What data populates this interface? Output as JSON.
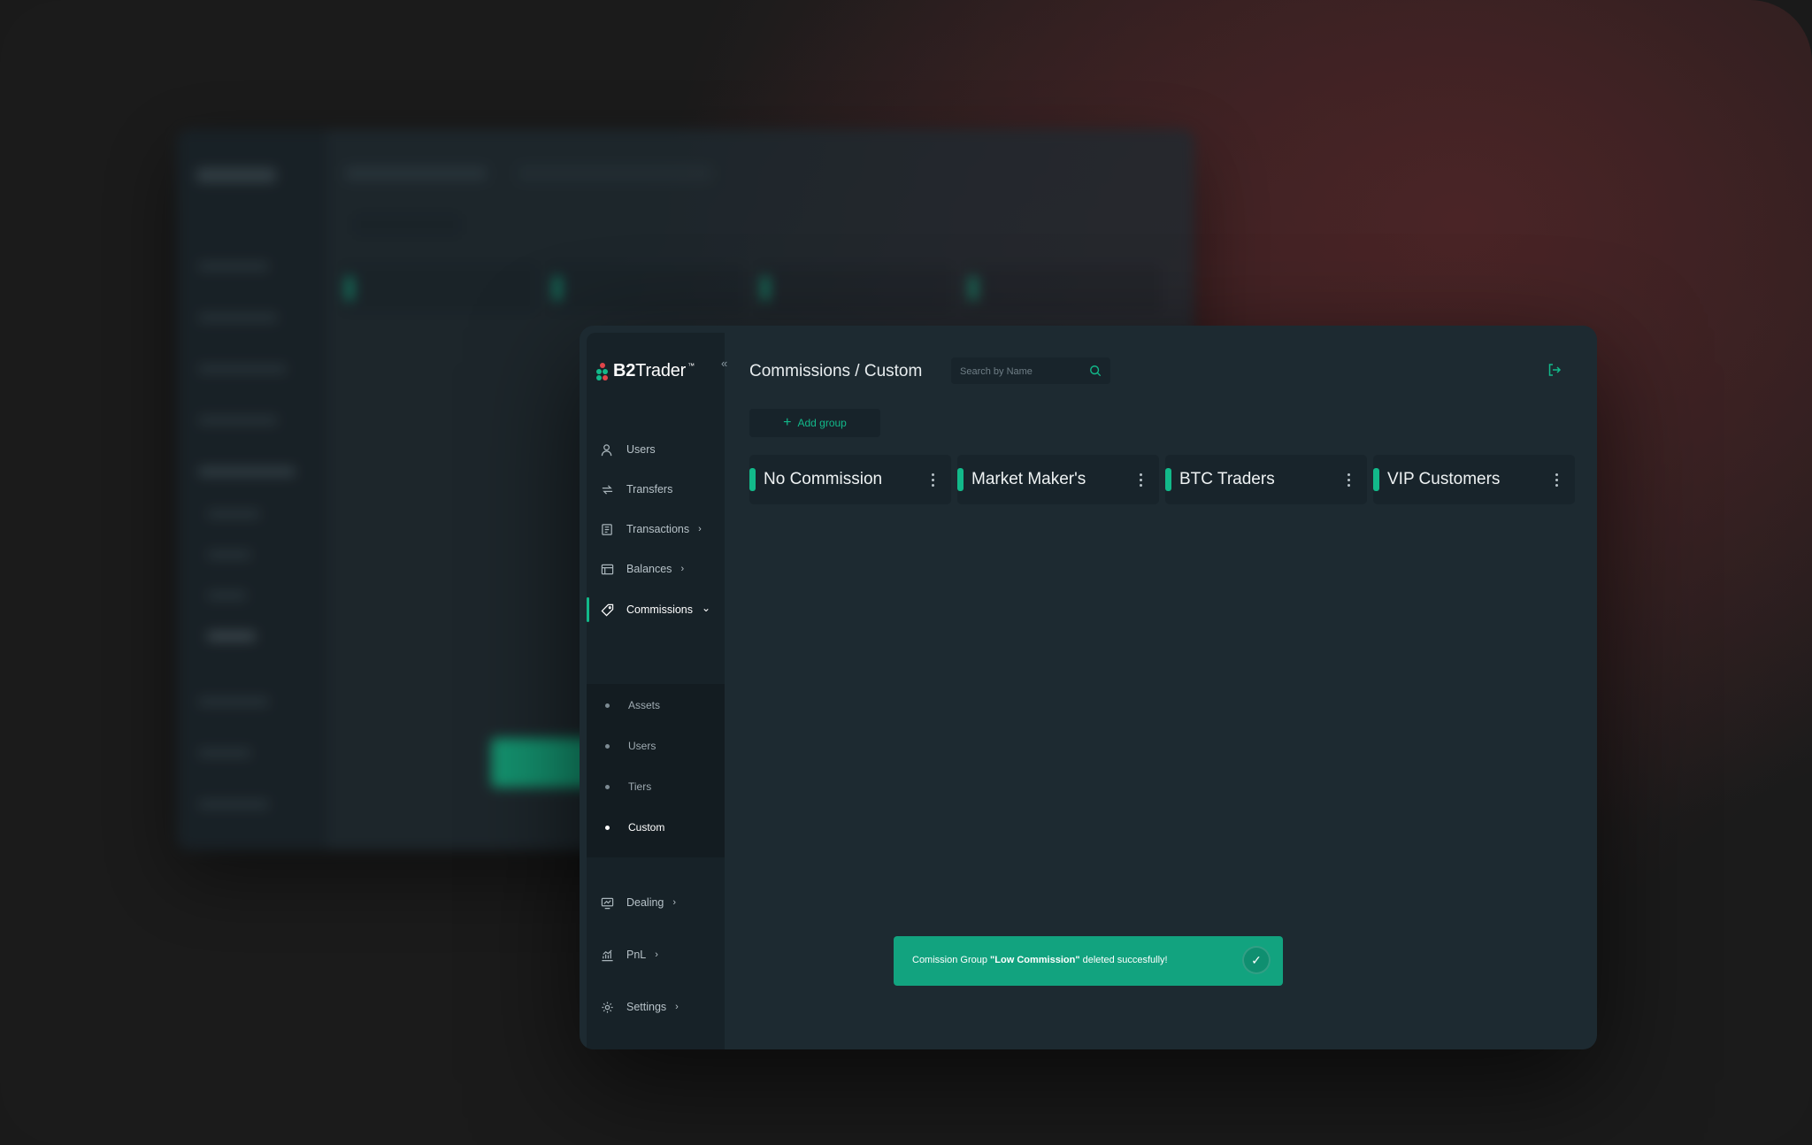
{
  "brand": {
    "name_bold": "B2",
    "name_rest": "Trader",
    "tm": "™",
    "colors": {
      "accent": "#12b98a",
      "logo_red": "#e0454a",
      "logo_green": "#12b98a"
    }
  },
  "sidebar": {
    "collapse_glyph": "«",
    "items": [
      {
        "label": "Users",
        "icon": "user-icon"
      },
      {
        "label": "Transfers",
        "icon": "transfer-icon"
      },
      {
        "label": "Transactions",
        "icon": "transactions-icon",
        "chevron": "›"
      },
      {
        "label": "Balances",
        "icon": "balances-icon",
        "chevron": "›"
      },
      {
        "label": "Commissions",
        "icon": "tag-icon",
        "chevron": "⌄",
        "active": true
      },
      {
        "label": "Dealing",
        "icon": "dealing-icon",
        "chevron": "›"
      },
      {
        "label": "PnL",
        "icon": "chart-icon",
        "chevron": "›"
      },
      {
        "label": "Settings",
        "icon": "gear-icon",
        "chevron": "›"
      }
    ],
    "submenu": [
      {
        "label": "Assets"
      },
      {
        "label": "Users"
      },
      {
        "label": "Tiers"
      },
      {
        "label": "Custom",
        "current": true
      }
    ]
  },
  "header": {
    "breadcrumb": "Commissions / Custom",
    "search_placeholder": "Search by Name"
  },
  "main": {
    "add_group_label": "Add group",
    "groups": [
      {
        "name": "No Commission"
      },
      {
        "name": "Market Maker's"
      },
      {
        "name": "BTC Traders"
      },
      {
        "name": "VIP Customers"
      }
    ]
  },
  "toast": {
    "prefix": "Comission Group ",
    "group": "\"Low Commission\"",
    "suffix": " deleted succesfully!",
    "check": "✓"
  }
}
